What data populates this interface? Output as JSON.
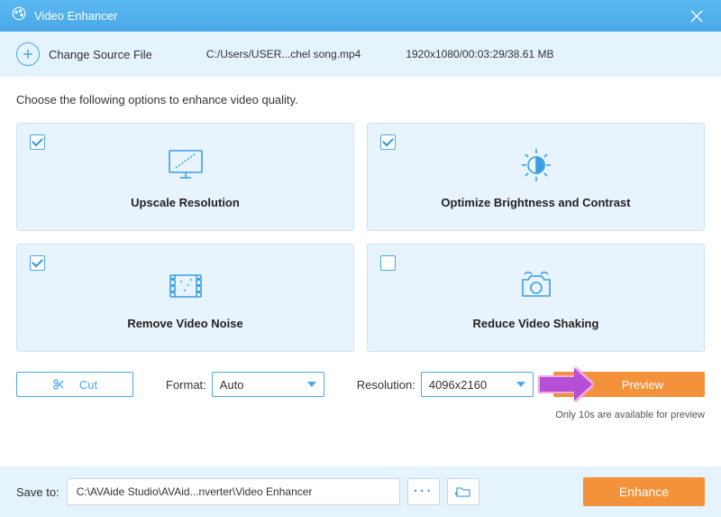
{
  "titlebar": {
    "title": "Video Enhancer"
  },
  "subbar": {
    "change_label": "Change Source File",
    "filepath": "C:/Users/USER...chel song.mp4",
    "fileinfo": "1920x1080/00:03:29/38.61 MB"
  },
  "instruction": "Choose the following options to enhance video quality.",
  "options": [
    {
      "id": "upscale",
      "label": "Upscale Resolution",
      "checked": true
    },
    {
      "id": "brightness",
      "label": "Optimize Brightness and Contrast",
      "checked": true
    },
    {
      "id": "noise",
      "label": "Remove Video Noise",
      "checked": true
    },
    {
      "id": "shaking",
      "label": "Reduce Video Shaking",
      "checked": false
    }
  ],
  "controls": {
    "cut_label": "Cut",
    "format_label": "Format:",
    "format_value": "Auto",
    "resolution_label": "Resolution:",
    "resolution_value": "4096x2160",
    "preview_label": "Preview"
  },
  "note": "Only 10s are available for preview",
  "footer": {
    "save_label": "Save to:",
    "save_path": "C:\\AVAide Studio\\AVAid...nverter\\Video Enhancer",
    "enhance_label": "Enhance"
  },
  "colors": {
    "accent": "#4aa8e8",
    "action": "#f3923a"
  }
}
